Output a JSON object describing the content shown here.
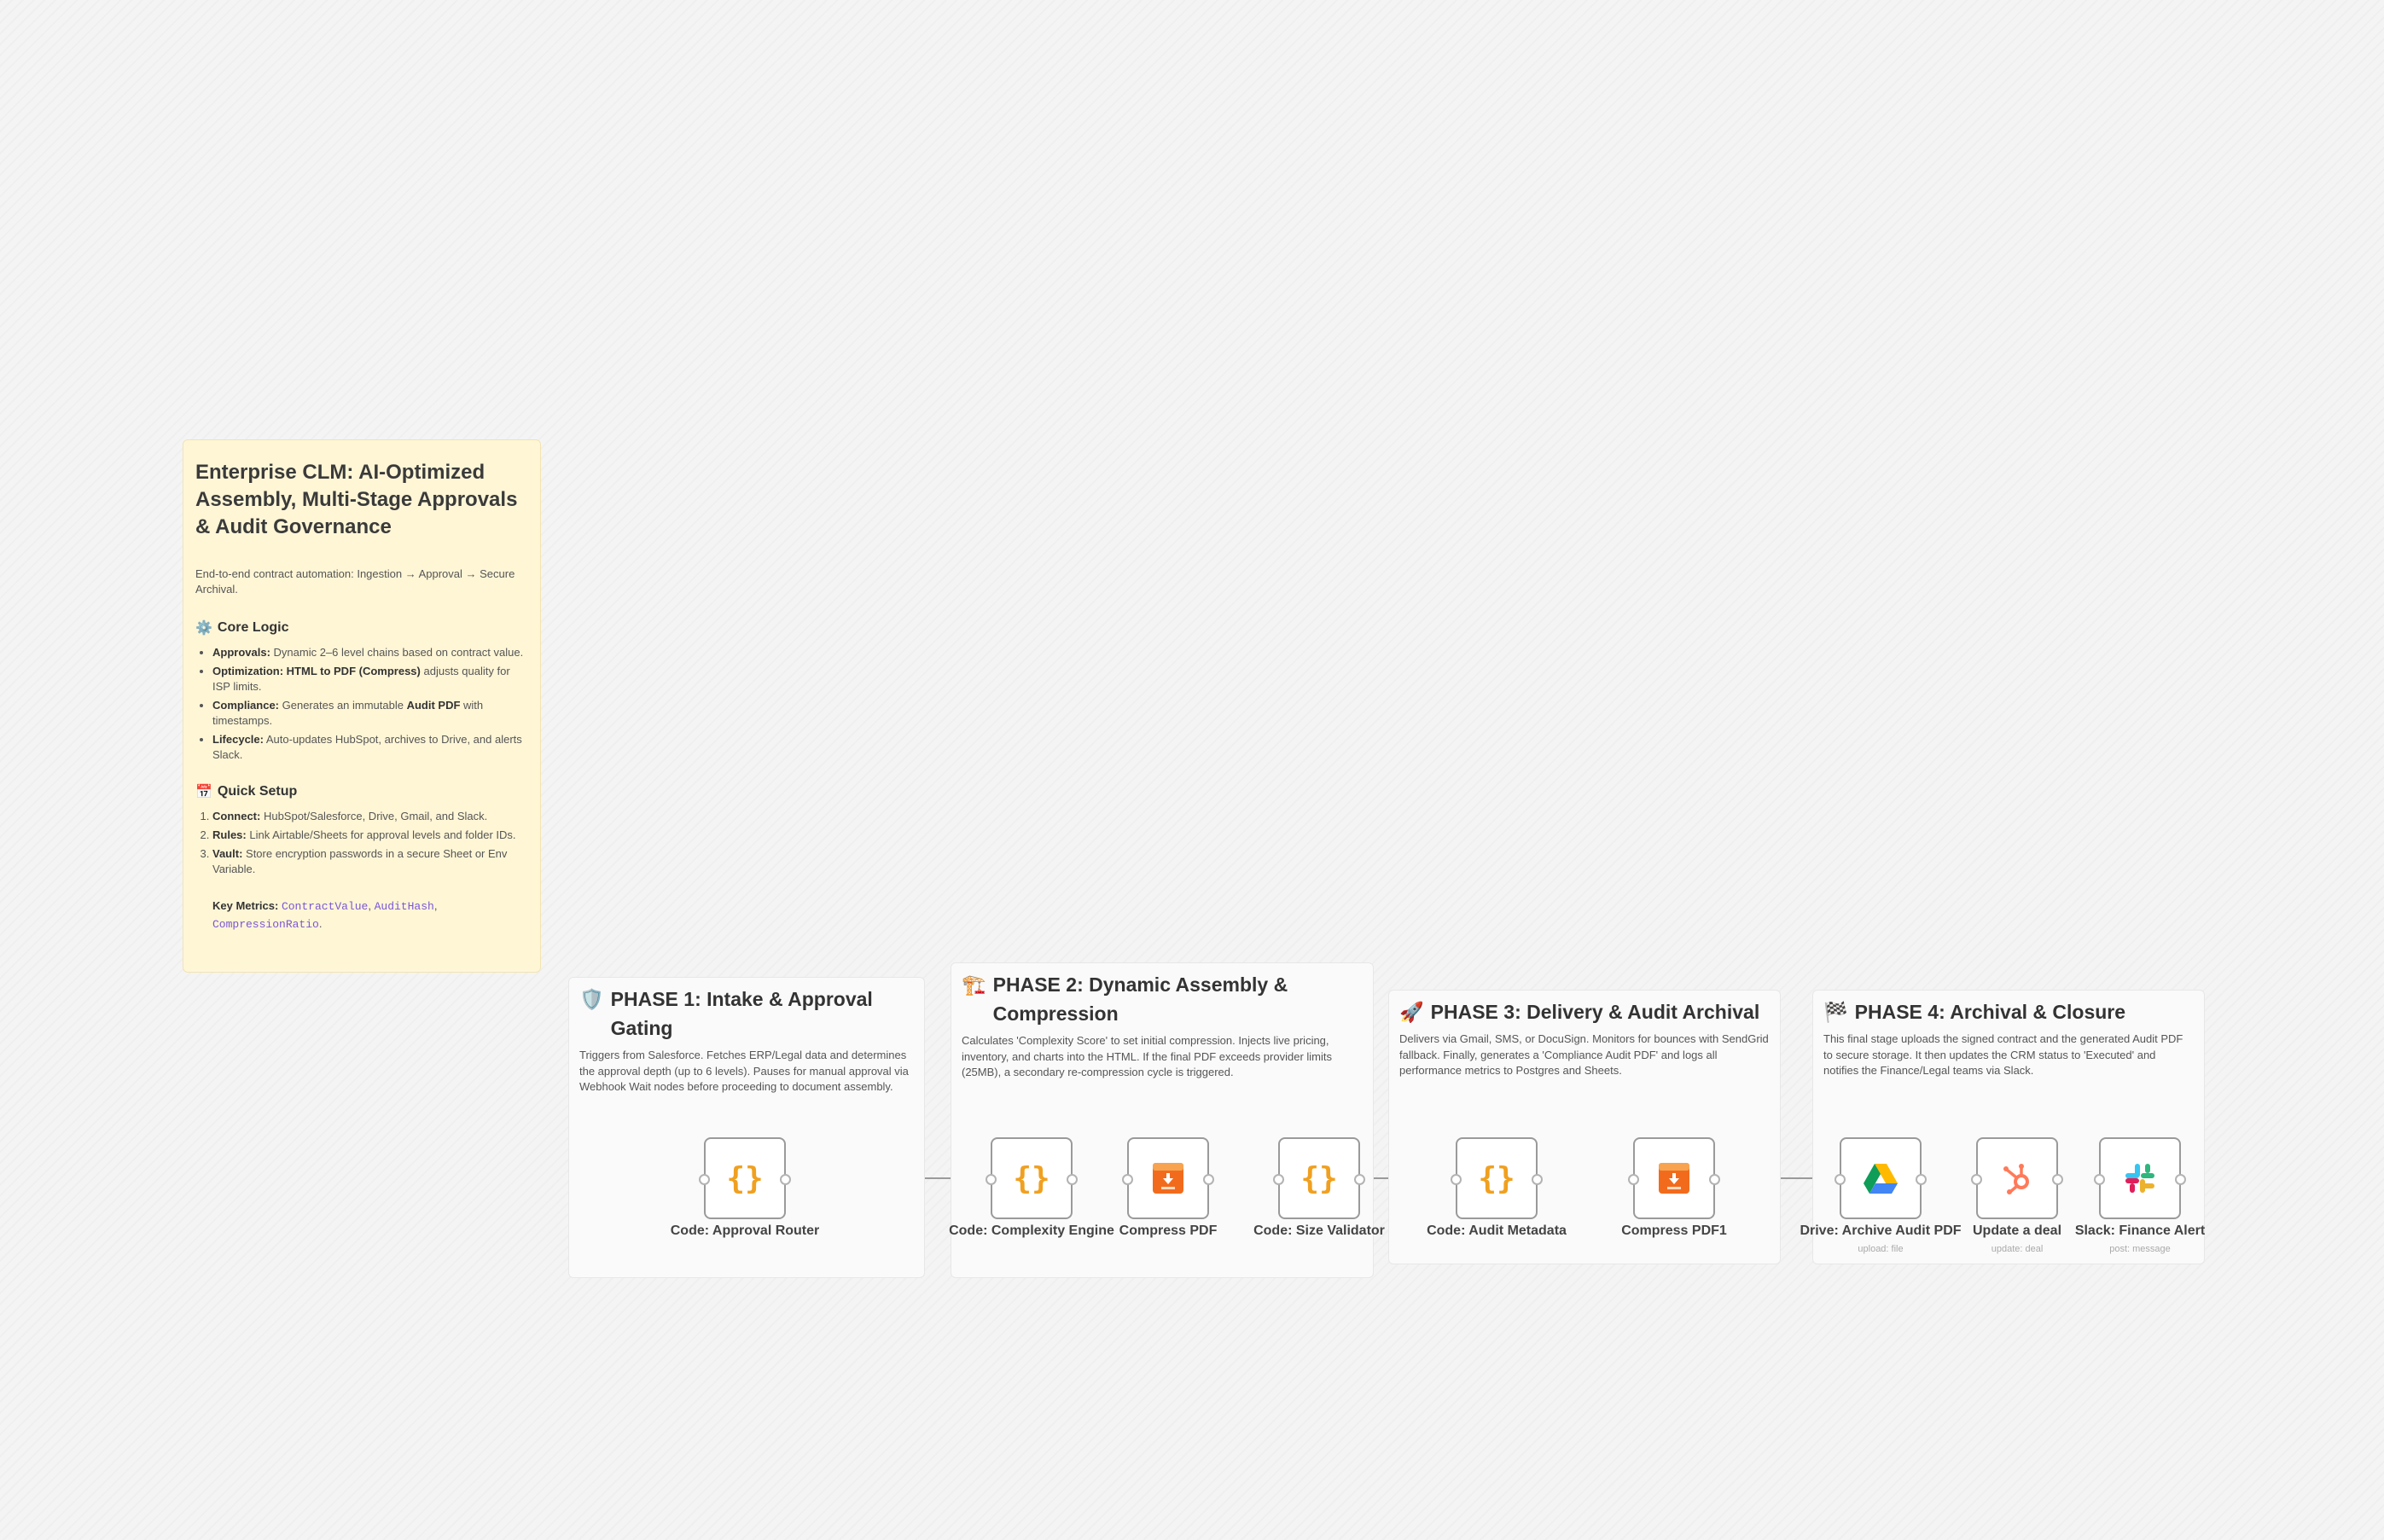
{
  "main_note": {
    "title": "Enterprise CLM: AI-Optimized Assembly, Multi-Stage Approvals & Audit Governance",
    "subtitle": "End-to-end contract automation: Ingestion → Approval → Secure Archival.",
    "core_logic": {
      "title": "Core Logic",
      "items": [
        {
          "label": "Approvals:",
          "text": " Dynamic 2–6 level chains based on contract value."
        },
        {
          "label": "Optimization: HTML to PDF (Compress)",
          "text": " adjusts quality for ISP limits."
        },
        {
          "label": "Compliance:",
          "text": " Generates an immutable ",
          "bold2": "Audit PDF",
          "text2": " with timestamps."
        },
        {
          "label": "Lifecycle:",
          "text": " Auto-updates HubSpot, archives to Drive, and alerts Slack."
        }
      ]
    },
    "quick_setup": {
      "title": "Quick Setup",
      "items": [
        {
          "label": "Connect:",
          "text": " HubSpot/Salesforce, Drive, Gmail, and Slack."
        },
        {
          "label": "Rules:",
          "text": " Link Airtable/Sheets for approval levels and folder IDs."
        },
        {
          "label": "Vault:",
          "text": " Store encryption passwords in a secure Sheet or Env Variable."
        }
      ]
    },
    "metrics_label": "Key Metrics:",
    "metrics": [
      "ContractValue",
      "AuditHash",
      "CompressionRatio"
    ]
  },
  "phases": [
    {
      "icon": "🛡️",
      "title": "PHASE 1: Intake & Approval Gating",
      "desc": "Triggers from Salesforce. Fetches ERP/Legal data and determines the approval depth (up to 6 levels). Pauses for manual approval via Webhook Wait nodes before proceeding to document assembly."
    },
    {
      "icon": "🏗️",
      "title": "PHASE 2: Dynamic Assembly & Compression",
      "desc": "Calculates 'Complexity Score' to set initial compression. Injects live pricing, inventory, and charts into the HTML. If the final PDF exceeds provider limits (25MB), a secondary re-compression cycle is triggered."
    },
    {
      "icon": "🚀",
      "title": "PHASE 3: Delivery & Audit Archival",
      "desc": "Delivers via Gmail, SMS, or DocuSign. Monitors for bounces with SendGrid fallback. Finally, generates a 'Compliance Audit PDF' and logs all performance metrics to Postgres and Sheets."
    },
    {
      "icon": "🏁",
      "title": "PHASE 4: Archival & Closure",
      "desc": "This final stage uploads the signed contract and the generated Audit PDF to secure storage. It then updates the CRM status to 'Executed' and notifies the Finance/Legal teams via Slack."
    }
  ],
  "nodes": [
    {
      "label": "Code: Approval Router",
      "sub": "",
      "icon": "code-icon"
    },
    {
      "label": "Code: Complexity Engine",
      "sub": "",
      "icon": "code-icon"
    },
    {
      "label": "Compress PDF",
      "sub": "",
      "icon": "html-pdf-icon"
    },
    {
      "label": "Code: Size Validator",
      "sub": "",
      "icon": "code-icon"
    },
    {
      "label": "Code: Audit Metadata",
      "sub": "",
      "icon": "code-icon"
    },
    {
      "label": "Compress PDF1",
      "sub": "",
      "icon": "html-pdf-icon"
    },
    {
      "label": "Drive: Archive Audit PDF",
      "sub": "upload: file",
      "icon": "google-drive-icon"
    },
    {
      "label": "Update a deal",
      "sub": "update: deal",
      "icon": "hubspot-icon"
    },
    {
      "label": "Slack: Finance Alert",
      "sub": "post: message",
      "icon": "slack-icon"
    }
  ],
  "colors": {
    "note_bg": "#fff6d6",
    "code_orange": "#f0a020",
    "metric_purple": "#7a56d6"
  }
}
